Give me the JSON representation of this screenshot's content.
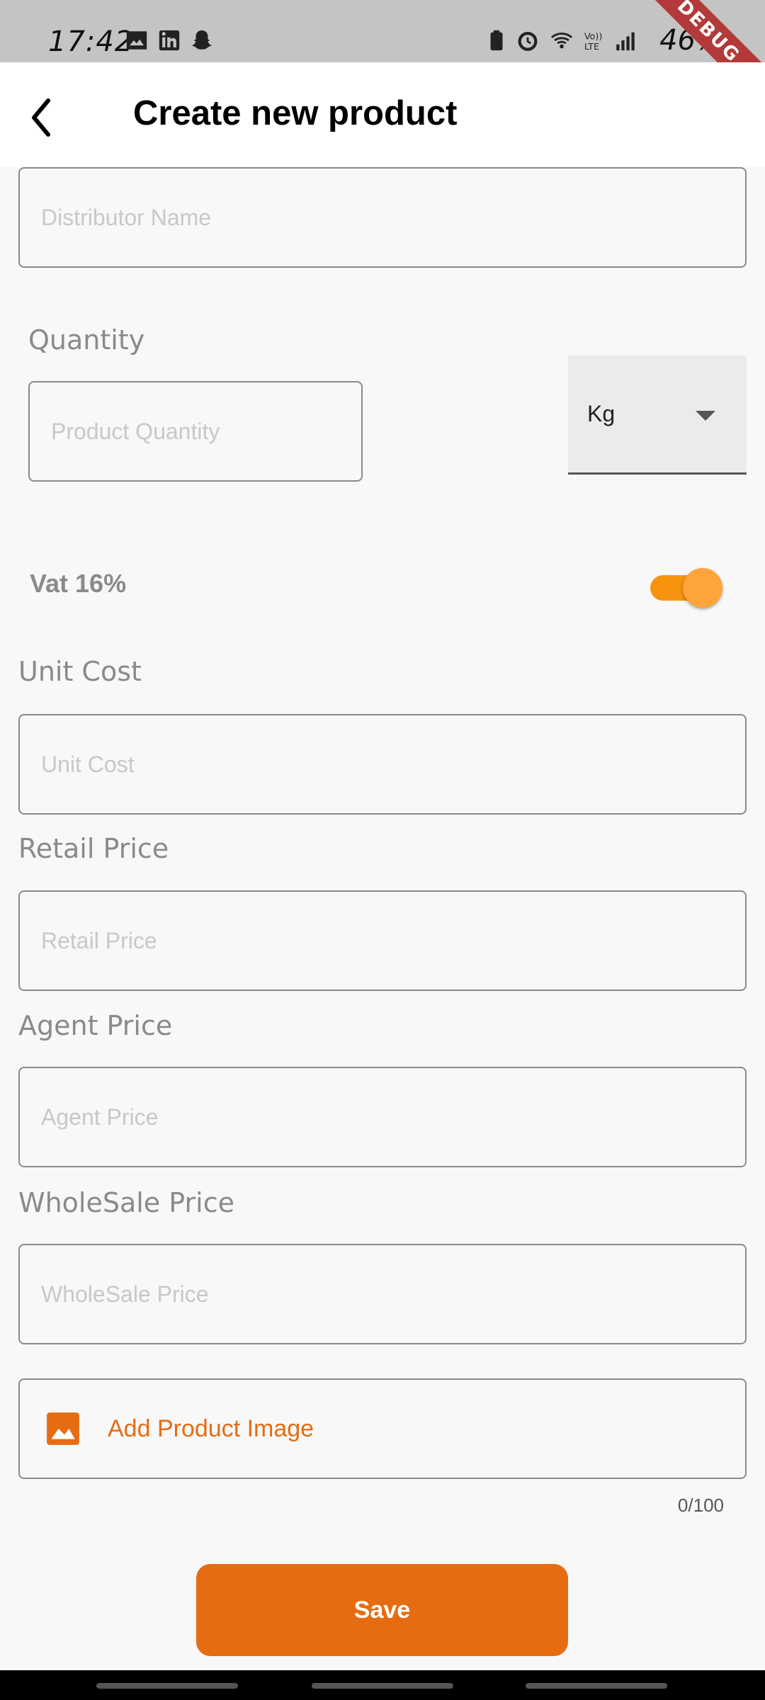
{
  "status_bar": {
    "time": "17:42",
    "battery": "46%",
    "debug_label": "DEBUG"
  },
  "app_bar": {
    "title": "Create new product"
  },
  "form": {
    "distributor": {
      "placeholder": "Distributor Name"
    },
    "quantity": {
      "label": "Quantity",
      "placeholder": "Product Quantity",
      "unit_selected": "Kg"
    },
    "vat": {
      "label": "Vat 16%",
      "enabled": true
    },
    "unit_cost": {
      "label": "Unit Cost",
      "placeholder": "Unit Cost"
    },
    "retail_price": {
      "label": "Retail Price",
      "placeholder": "Retail Price"
    },
    "agent_price": {
      "label": "Agent Price",
      "placeholder": "Agent Price"
    },
    "wholesale_price": {
      "label": "WholeSale Price",
      "placeholder": "WholeSale Price"
    },
    "image": {
      "label": "Add Product Image",
      "counter": "0/100"
    }
  },
  "actions": {
    "save_label": "Save"
  },
  "colors": {
    "accent": "#e66c12",
    "toggle": "#f7930f"
  }
}
